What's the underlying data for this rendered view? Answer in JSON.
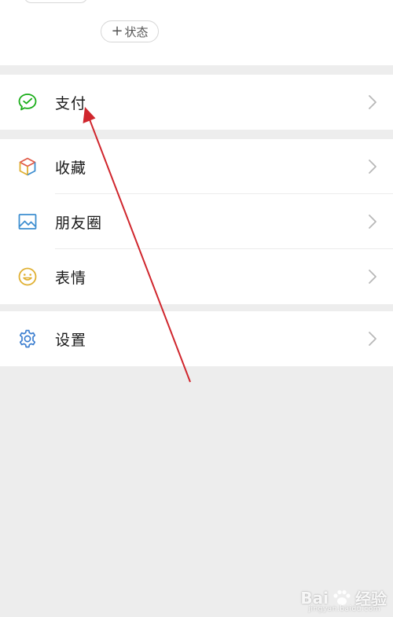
{
  "header": {
    "status_button_plus": "+",
    "status_button_label": "状态"
  },
  "menu": {
    "pay": {
      "label": "支付",
      "icon": "wechat-pay-icon"
    },
    "favorites": {
      "label": "收藏",
      "icon": "cube-icon"
    },
    "moments": {
      "label": "朋友圈",
      "icon": "picture-icon"
    },
    "stickers": {
      "label": "表情",
      "icon": "smiley-icon"
    },
    "settings": {
      "label": "设置",
      "icon": "gear-icon"
    }
  },
  "watermark": {
    "brand": "Bai",
    "suffix": "经验",
    "url": "jingyan.baidu.com"
  },
  "colors": {
    "pay_green": "#1aad19",
    "moments_blue": "#3d8ed0",
    "stickers_yellow": "#e0b032",
    "settings_blue": "#3d7fd0",
    "annotation_red": "#d0262d",
    "chevron": "#b8b8b8"
  }
}
